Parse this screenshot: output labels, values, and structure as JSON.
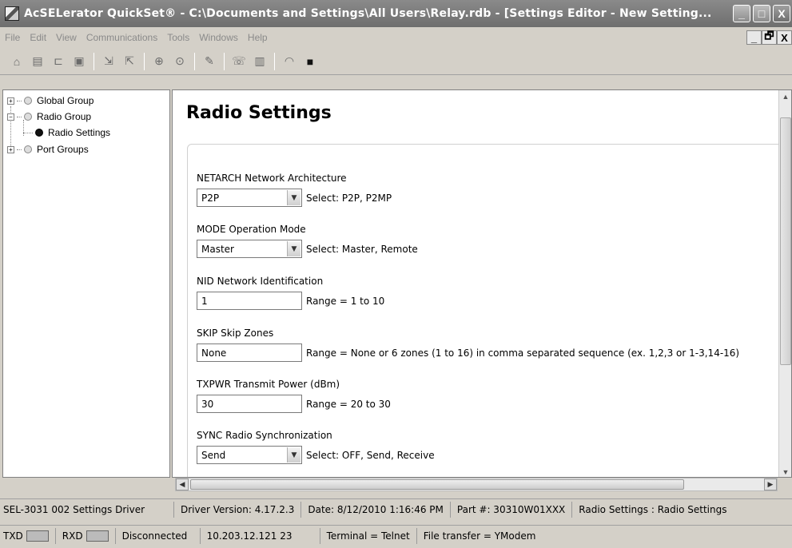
{
  "window": {
    "title": "AcSELerator QuickSet® - C:\\Documents and Settings\\All Users\\Relay.rdb - [Settings Editor - New Setting...",
    "buttons": {
      "minimize": "_",
      "maximize": "□",
      "close": "X"
    }
  },
  "menu": {
    "items": [
      "File",
      "Edit",
      "View",
      "Communications",
      "Tools",
      "Windows",
      "Help"
    ],
    "mdi": {
      "minimize": "_",
      "restore": "🗗",
      "close": "X"
    }
  },
  "toolbar": {
    "icons": [
      "home-icon",
      "new-document-icon",
      "open-folder-icon",
      "save-icon",
      "import-icon",
      "export-icon",
      "download-icon",
      "upload-icon",
      "abc-settings-icon",
      "connect-icon",
      "device-icon",
      "meter-icon",
      "terminal-icon"
    ]
  },
  "tree": {
    "items": [
      {
        "label": "Global Group",
        "expander": "+"
      },
      {
        "label": "Radio Group",
        "expander": "−"
      },
      {
        "label": "Radio Settings"
      },
      {
        "label": "Port Groups",
        "expander": "+"
      }
    ]
  },
  "editor": {
    "title": "Radio Settings",
    "settings": [
      {
        "label": "NETARCH  Network Architecture",
        "value": "P2P",
        "type": "dropdown",
        "hint": "Select: P2P, P2MP"
      },
      {
        "label": "MODE  Operation Mode",
        "value": "Master",
        "type": "dropdown",
        "hint": "Select: Master, Remote"
      },
      {
        "label": "NID  Network Identification",
        "value": "1",
        "type": "text",
        "hint": "Range = 1 to 10"
      },
      {
        "label": "SKIP  Skip Zones",
        "value": "None",
        "type": "text",
        "hint": "Range = None or 6 zones (1 to 16) in comma separated sequence (ex. 1,2,3 or 1-3,14-16)"
      },
      {
        "label": "TXPWR  Transmit Power (dBm)",
        "value": "30",
        "type": "text",
        "hint": "Range = 20 to 30"
      },
      {
        "label": "SYNC  Radio Synchronization",
        "value": "Send",
        "type": "dropdown",
        "hint": "Select: OFF, Send, Receive"
      }
    ]
  },
  "status1": {
    "driver": "SEL-3031 002 Settings Driver",
    "version": "Driver Version: 4.17.2.3",
    "date": "Date: 8/12/2010 1:16:46 PM",
    "part": "Part #: 30310W01XXX",
    "location": "Radio Settings : Radio Settings"
  },
  "status2": {
    "txd": "TXD",
    "rxd": "RXD",
    "connection": "Disconnected",
    "address": "10.203.12.121  23",
    "terminal": "Terminal = Telnet",
    "transfer": "File transfer = YModem"
  }
}
